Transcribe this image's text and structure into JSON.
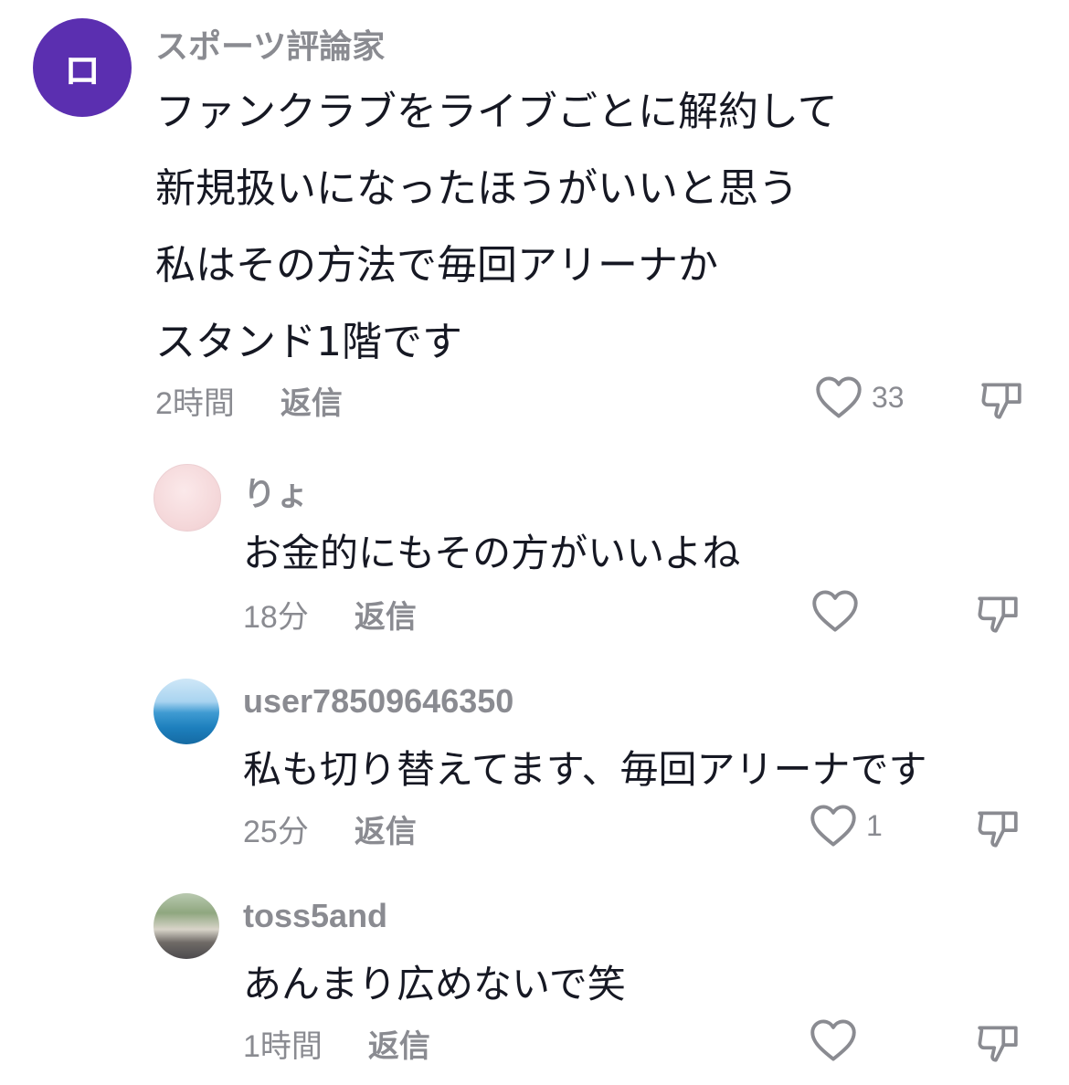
{
  "comments": [
    {
      "avatar_initial": "ロ",
      "avatar_color": "#5b2fb0",
      "username": "スポーツ評論家",
      "lines": [
        "ファンクラブをライブごとに解約して",
        "新規扱いになったほうがいいと思う",
        "私はその方法で毎回アリーナか",
        "スタンド1階です"
      ],
      "time": "2時間",
      "reply_label": "返信",
      "like_count": "33"
    },
    {
      "username": "りょ",
      "lines": [
        "お金的にもその方がいいよね"
      ],
      "time": "18分",
      "reply_label": "返信",
      "like_count": ""
    },
    {
      "username": "user78509646350",
      "lines": [
        "私も切り替えてます、毎回アリーナです"
      ],
      "time": "25分",
      "reply_label": "返信",
      "like_count": "1"
    },
    {
      "username": "toss5and",
      "lines": [
        "あんまり広めないで笑"
      ],
      "time": "1時間",
      "reply_label": "返信",
      "like_count": ""
    }
  ],
  "icons": {
    "like": "heart-outline-icon",
    "dislike": "thumbs-down-outline-icon"
  },
  "colors": {
    "meta_gray": "#8a8b91",
    "text": "#161823"
  }
}
